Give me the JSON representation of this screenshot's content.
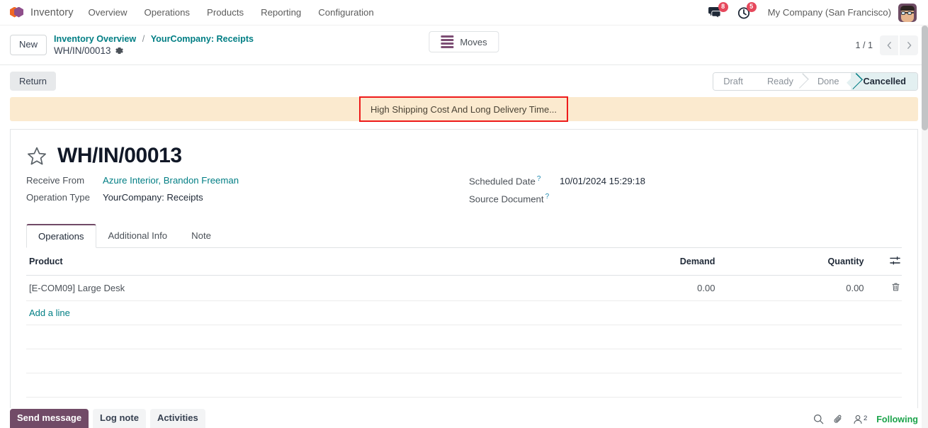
{
  "navbar": {
    "logo_icon": "odoo-cube-icon",
    "app_name": "Inventory",
    "menu": [
      {
        "label": "Overview"
      },
      {
        "label": "Operations"
      },
      {
        "label": "Products"
      },
      {
        "label": "Reporting"
      },
      {
        "label": "Configuration"
      }
    ],
    "messages_icon": "chat-bubble-icon",
    "messages_count": "8",
    "activities_icon": "clock-icon",
    "activities_count": "5",
    "company": "My Company (San Francisco)",
    "avatar_icon": "user-avatar"
  },
  "control_panel": {
    "new_label": "New",
    "breadcrumb": {
      "root": "Inventory Overview",
      "separator": "/",
      "parent": "YourCompany: Receipts",
      "current": "WH/IN/00013",
      "settings_icon": "gear-icon"
    },
    "smart_button": {
      "label": "Moves",
      "icon": "list-lines-icon"
    },
    "pager": {
      "value": "1 / 1",
      "prev_icon": "chevron-left-icon",
      "next_icon": "chevron-right-icon"
    }
  },
  "actions": {
    "return_label": "Return"
  },
  "statusbar": {
    "states": [
      {
        "label": "Draft",
        "active": false
      },
      {
        "label": "Ready",
        "active": false
      },
      {
        "label": "Done",
        "active": false
      },
      {
        "label": "Cancelled",
        "active": true
      }
    ],
    "active_color": "#017e84"
  },
  "alert": {
    "text": "High Shipping Cost And Long Delivery Time...",
    "background_color": "#fbeacf",
    "highlight_color": "#ee1b1b"
  },
  "record": {
    "favorite_icon": "star-outline-icon",
    "title": "WH/IN/00013",
    "fields_left": [
      {
        "label": "Receive From",
        "value": "Azure Interior, Brandon Freeman",
        "is_link": true,
        "help": false
      },
      {
        "label": "Operation Type",
        "value": "YourCompany: Receipts",
        "is_link": false,
        "help": false
      }
    ],
    "fields_right": [
      {
        "label": "Scheduled Date",
        "value": "10/01/2024 15:29:18",
        "is_link": false,
        "help": true
      },
      {
        "label": "Source Document",
        "value": "",
        "is_link": false,
        "help": true
      }
    ],
    "help_marker": "?"
  },
  "notebook": {
    "tabs": [
      {
        "label": "Operations",
        "active": true
      },
      {
        "label": "Additional Info",
        "active": false
      },
      {
        "label": "Note",
        "active": false
      }
    ]
  },
  "lines_table": {
    "columns": [
      "Product",
      "Demand",
      "Quantity"
    ],
    "optional_columns_icon": "column-settings-icon",
    "rows": [
      {
        "product": "[E-COM09] Large Desk",
        "demand": "0.00",
        "quantity": "0.00",
        "delete_icon": "trash-icon"
      }
    ],
    "add_line_label": "Add a line"
  },
  "chatter": {
    "send_message_label": "Send message",
    "log_note_label": "Log note",
    "activities_label": "Activities",
    "search_icon": "search-icon",
    "attachment_icon": "paperclip-icon",
    "followers_icon": "user-icon",
    "followers_count": "2",
    "following_label": "Following",
    "following_color": "#1aa34a"
  }
}
